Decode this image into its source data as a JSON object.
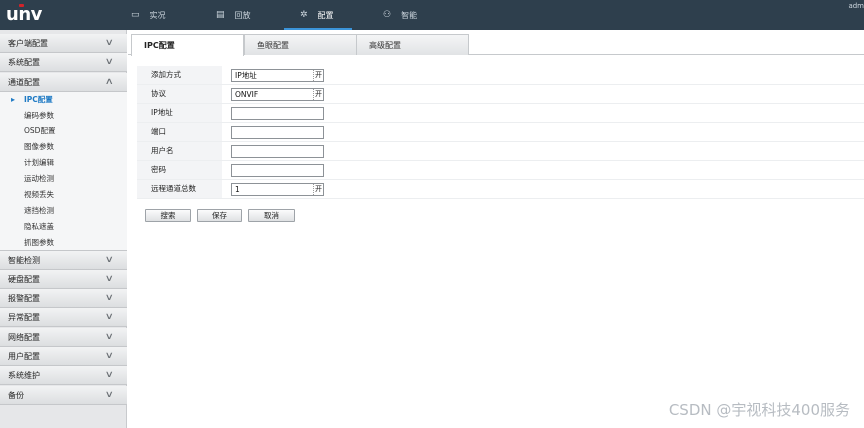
{
  "brand": {
    "logo": "unv"
  },
  "header": {
    "nav": [
      {
        "label": "实况",
        "icon": "monitor-icon"
      },
      {
        "label": "回放",
        "icon": "playback-icon"
      },
      {
        "label": "配置",
        "icon": "gear-icon",
        "active": true
      },
      {
        "label": "智能",
        "icon": "smart-icon"
      }
    ],
    "user": "adm"
  },
  "sidebar": {
    "sections_top": [
      "客户端配置",
      "系统配置",
      "通道配置"
    ],
    "channel_items": [
      "IPC配置",
      "编码参数",
      "OSD配置",
      "图像参数",
      "计划编辑",
      "运动检测",
      "视频丢失",
      "遮挡检测",
      "隐私遮盖",
      "抓图参数"
    ],
    "sections_bottom": [
      "智能检测",
      "硬盘配置",
      "报警配置",
      "异常配置",
      "网络配置",
      "用户配置",
      "系统维护",
      "备份"
    ]
  },
  "tabs": [
    "IPC配置",
    "鱼眼配置",
    "高级配置"
  ],
  "form": {
    "rows": [
      {
        "label": "添加方式",
        "value": "IP地址",
        "dropdown": true
      },
      {
        "label": "协议",
        "value": "ONVIF",
        "dropdown": true
      },
      {
        "label": "IP地址",
        "value": "",
        "dropdown": false
      },
      {
        "label": "端口",
        "value": "",
        "dropdown": false
      },
      {
        "label": "用户名",
        "value": "",
        "dropdown": false
      },
      {
        "label": "密码",
        "value": "",
        "dropdown": false
      },
      {
        "label": "远程通道总数",
        "value": "1",
        "dropdown": true
      }
    ],
    "dropdown_glyph": "开"
  },
  "buttons": {
    "search": "搜索",
    "save": "保存",
    "cancel": "取消"
  },
  "watermark": "CSDN @宇视科技400服务",
  "colors": {
    "topbar": "#2e3f4d",
    "accent": "#3b94d9",
    "active_link": "#1f7ac4",
    "brand_dot": "#d2232a"
  }
}
